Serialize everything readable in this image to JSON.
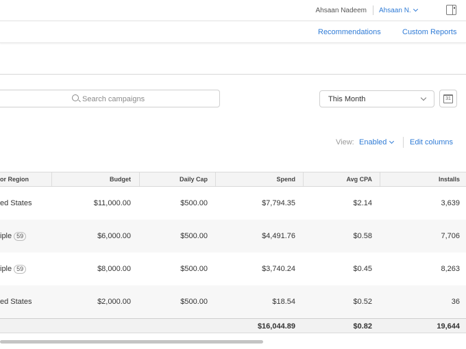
{
  "user": {
    "name": "Ahsaan Nadeem",
    "account_menu": "Ahsaan N."
  },
  "nav": {
    "recommendations": "Recommendations",
    "custom_reports": "Custom Reports"
  },
  "search": {
    "placeholder": "Search campaigns"
  },
  "date_range": {
    "selected": "This Month",
    "calendar_day": "31"
  },
  "view": {
    "label": "View:",
    "selected": "Enabled",
    "edit_columns": "Edit columns"
  },
  "table": {
    "headers": {
      "region": "or Region",
      "budget": "Budget",
      "daily_cap": "Daily Cap",
      "spend": "Spend",
      "avg_cpa": "Avg CPA",
      "installs": "Installs"
    },
    "rows": [
      {
        "region": "ed States",
        "badge": "",
        "budget": "$11,000.00",
        "daily_cap": "$500.00",
        "spend": "$7,794.35",
        "avg_cpa": "$2.14",
        "installs": "3,639"
      },
      {
        "region": "iple",
        "badge": "59",
        "budget": "$6,000.00",
        "daily_cap": "$500.00",
        "spend": "$4,491.76",
        "avg_cpa": "$0.58",
        "installs": "7,706"
      },
      {
        "region": "iple",
        "badge": "59",
        "budget": "$8,000.00",
        "daily_cap": "$500.00",
        "spend": "$3,740.24",
        "avg_cpa": "$0.45",
        "installs": "8,263"
      },
      {
        "region": "ed States",
        "badge": "",
        "budget": "$2,000.00",
        "daily_cap": "$500.00",
        "spend": "$18.54",
        "avg_cpa": "$0.52",
        "installs": "36"
      }
    ],
    "totals": {
      "spend": "$16,044.89",
      "avg_cpa": "$0.82",
      "installs": "19,644"
    }
  },
  "colors": {
    "accent": "#2f7bd6",
    "header_bg": "#f4f4f4",
    "row_alt": "#f7f7f7"
  }
}
